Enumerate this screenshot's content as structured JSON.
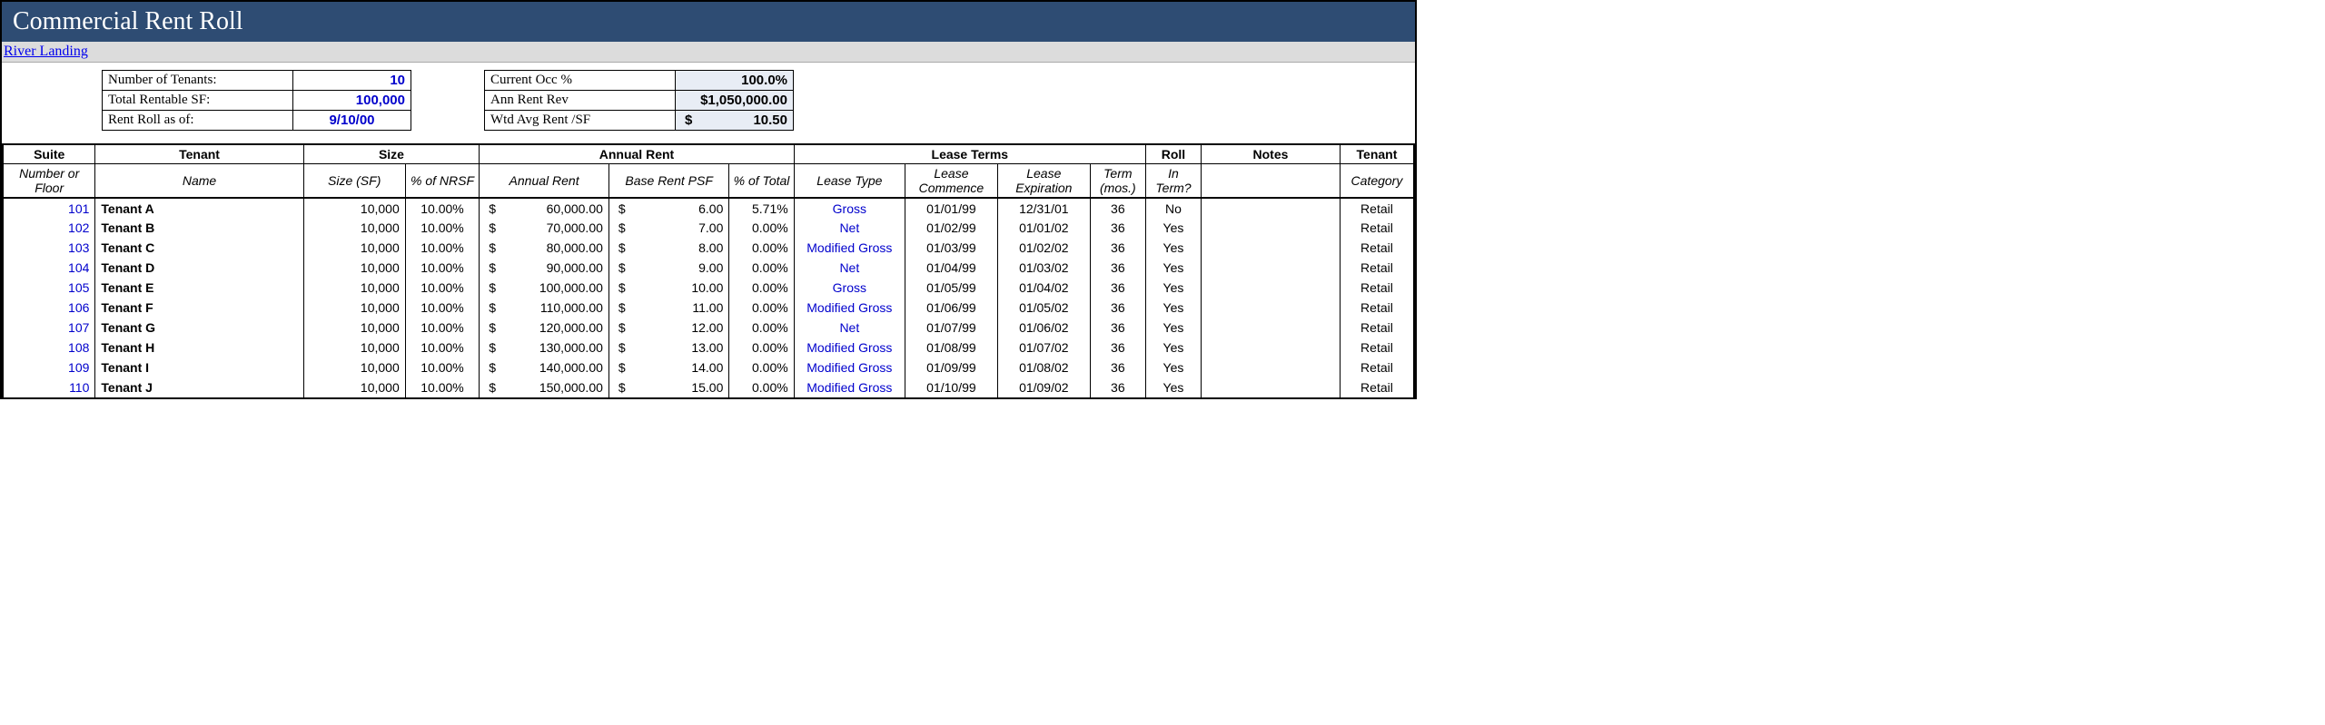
{
  "title": "Commercial Rent Roll",
  "property_name": "River Landing",
  "summary_left": {
    "num_tenants_label": "Number of Tenants:",
    "num_tenants": "10",
    "total_sf_label": "Total Rentable SF:",
    "total_sf": "100,000",
    "asof_label": "Rent Roll as of:",
    "asof": "9/10/00"
  },
  "summary_right": {
    "occ_label": "Current Occ %",
    "occ": "100.0%",
    "rev_label": "Ann Rent Rev",
    "rev": "$1,050,000.00",
    "avg_label": "Wtd Avg Rent /SF",
    "avg_sym": "$",
    "avg_val": "10.50"
  },
  "headers": {
    "g_suite": "Suite",
    "g_tenant": "Tenant",
    "g_size": "Size",
    "g_rent": "Annual Rent",
    "g_lease": "Lease Terms",
    "g_roll": "Roll",
    "g_notes": "Notes",
    "g_cat": "Tenant",
    "s_suite": "Number or Floor",
    "s_tenant": "Name",
    "s_size": "Size (SF)",
    "s_nrsf": "% of NRSF",
    "s_annual": "Annual Rent",
    "s_psf": "Base Rent PSF",
    "s_pct": "% of Total",
    "s_ltype": "Lease Type",
    "s_comm": "Lease Commence",
    "s_exp": "Lease Expiration",
    "s_term": "Term (mos.)",
    "s_roll": "In Term?",
    "s_cat": "Category"
  },
  "rows": [
    {
      "suite": "101",
      "tenant": "Tenant A",
      "size": "10,000",
      "nrsf": "10.00%",
      "rent": "60,000.00",
      "psf": "6.00",
      "pct": "5.71%",
      "ltype": "Gross",
      "comm": "01/01/99",
      "exp": "12/31/01",
      "term": "36",
      "roll": "No",
      "notes": "",
      "cat": "Retail"
    },
    {
      "suite": "102",
      "tenant": "Tenant B",
      "size": "10,000",
      "nrsf": "10.00%",
      "rent": "70,000.00",
      "psf": "7.00",
      "pct": "0.00%",
      "ltype": "Net",
      "comm": "01/02/99",
      "exp": "01/01/02",
      "term": "36",
      "roll": "Yes",
      "notes": "",
      "cat": "Retail"
    },
    {
      "suite": "103",
      "tenant": "Tenant C",
      "size": "10,000",
      "nrsf": "10.00%",
      "rent": "80,000.00",
      "psf": "8.00",
      "pct": "0.00%",
      "ltype": "Modified Gross",
      "comm": "01/03/99",
      "exp": "01/02/02",
      "term": "36",
      "roll": "Yes",
      "notes": "",
      "cat": "Retail"
    },
    {
      "suite": "104",
      "tenant": "Tenant D",
      "size": "10,000",
      "nrsf": "10.00%",
      "rent": "90,000.00",
      "psf": "9.00",
      "pct": "0.00%",
      "ltype": "Net",
      "comm": "01/04/99",
      "exp": "01/03/02",
      "term": "36",
      "roll": "Yes",
      "notes": "",
      "cat": "Retail"
    },
    {
      "suite": "105",
      "tenant": "Tenant E",
      "size": "10,000",
      "nrsf": "10.00%",
      "rent": "100,000.00",
      "psf": "10.00",
      "pct": "0.00%",
      "ltype": "Gross",
      "comm": "01/05/99",
      "exp": "01/04/02",
      "term": "36",
      "roll": "Yes",
      "notes": "",
      "cat": "Retail"
    },
    {
      "suite": "106",
      "tenant": "Tenant F",
      "size": "10,000",
      "nrsf": "10.00%",
      "rent": "110,000.00",
      "psf": "11.00",
      "pct": "0.00%",
      "ltype": "Modified Gross",
      "comm": "01/06/99",
      "exp": "01/05/02",
      "term": "36",
      "roll": "Yes",
      "notes": "",
      "cat": "Retail"
    },
    {
      "suite": "107",
      "tenant": "Tenant G",
      "size": "10,000",
      "nrsf": "10.00%",
      "rent": "120,000.00",
      "psf": "12.00",
      "pct": "0.00%",
      "ltype": "Net",
      "comm": "01/07/99",
      "exp": "01/06/02",
      "term": "36",
      "roll": "Yes",
      "notes": "",
      "cat": "Retail"
    },
    {
      "suite": "108",
      "tenant": "Tenant H",
      "size": "10,000",
      "nrsf": "10.00%",
      "rent": "130,000.00",
      "psf": "13.00",
      "pct": "0.00%",
      "ltype": "Modified Gross",
      "comm": "01/08/99",
      "exp": "01/07/02",
      "term": "36",
      "roll": "Yes",
      "notes": "",
      "cat": "Retail"
    },
    {
      "suite": "109",
      "tenant": "Tenant I",
      "size": "10,000",
      "nrsf": "10.00%",
      "rent": "140,000.00",
      "psf": "14.00",
      "pct": "0.00%",
      "ltype": "Modified Gross",
      "comm": "01/09/99",
      "exp": "01/08/02",
      "term": "36",
      "roll": "Yes",
      "notes": "",
      "cat": "Retail"
    },
    {
      "suite": "110",
      "tenant": "Tenant J",
      "size": "10,000",
      "nrsf": "10.00%",
      "rent": "150,000.00",
      "psf": "15.00",
      "pct": "0.00%",
      "ltype": "Modified Gross",
      "comm": "01/10/99",
      "exp": "01/09/02",
      "term": "36",
      "roll": "Yes",
      "notes": "",
      "cat": "Retail"
    }
  ]
}
